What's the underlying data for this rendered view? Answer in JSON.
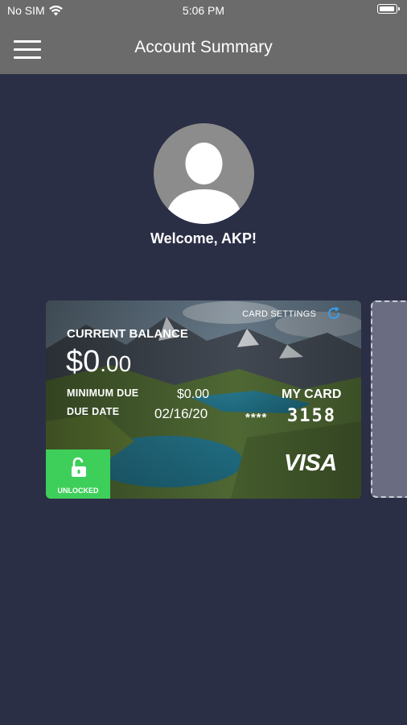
{
  "status_bar": {
    "carrier": "No SIM",
    "time": "5:06 PM",
    "icons": [
      "wifi-icon",
      "battery-icon"
    ]
  },
  "header": {
    "title": "Account Summary",
    "menu_icon": "hamburger-menu-icon",
    "background_color": "#6b6b6b"
  },
  "profile": {
    "avatar_icon": "user-silhouette-icon",
    "welcome_text": "Welcome, AKP!"
  },
  "card": {
    "settings_label": "CARD SETTINGS",
    "refresh_icon": "refresh-icon",
    "balance_label": "CURRENT BALANCE",
    "balance_dollars": "$0",
    "balance_cents": ".00",
    "minimum_due_label": "MINIMUM DUE",
    "minimum_due_value": "$0.00",
    "due_date_label": "DUE DATE",
    "due_date_value": "02/16/20",
    "card_name": "MY CARD",
    "card_mask": "****",
    "card_last4": "3158",
    "network": "VISA",
    "lock_status": "UNLOCKED",
    "lock_color": "#3ecf5a"
  },
  "colors": {
    "background": "#2b2f45",
    "accent_blue": "#3a9be8"
  }
}
